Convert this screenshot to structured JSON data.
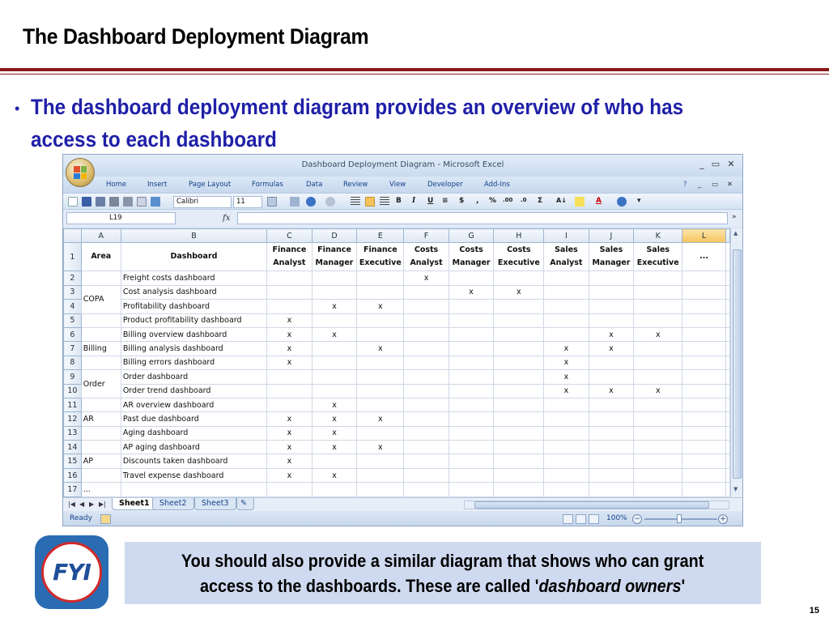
{
  "slide": {
    "title": "The Dashboard Deployment Diagram",
    "bullet": "The dashboard deployment diagram provides an overview of who has access to each dashboard",
    "bullet_line1": "The dashboard deployment diagram provides an overview of who has",
    "bullet_line2": "access to each dashboard",
    "note_pre": "You should also provide a similar diagram that shows who can grant",
    "note_line2_pre": "access to the dashboards. These are called '",
    "note_em": "dashboard owners",
    "note_post": "'",
    "fyi": "FYI",
    "page_number": "15",
    "accent_color": "#8b1a1a",
    "bullet_color": "#1f1fa8"
  },
  "excel": {
    "window_title": "Dashboard Deployment Diagram - Microsoft Excel",
    "ribbon_tabs": [
      "Home",
      "Insert",
      "Page Layout",
      "Formulas",
      "Data",
      "Review",
      "View",
      "Developer",
      "Add-Ins"
    ],
    "font_name": "Calibri",
    "font_size": "11",
    "name_box": "L19",
    "fx": "fx",
    "sheets": [
      "Sheet1",
      "Sheet2",
      "Sheet3"
    ],
    "active_sheet": "Sheet1",
    "status": "Ready",
    "zoom": "100%",
    "columns": [
      "A",
      "B",
      "C",
      "D",
      "E",
      "F",
      "G",
      "H",
      "I",
      "J",
      "K",
      "L"
    ],
    "selected_column": "L",
    "header_row": {
      "area": "Area",
      "dashboard": "Dashboard",
      "roles": [
        [
          "Finance",
          "Analyst"
        ],
        [
          "Finance",
          "Manager"
        ],
        [
          "Finance",
          "Executive"
        ],
        [
          "Costs",
          "Analyst"
        ],
        [
          "Costs",
          "Manager"
        ],
        [
          "Costs",
          "Executive"
        ],
        [
          "Sales",
          "Analyst"
        ],
        [
          "Sales",
          "Manager"
        ],
        [
          "Sales",
          "Executive"
        ]
      ],
      "more": "..."
    },
    "rows": [
      {
        "num": "2",
        "area": "",
        "dashboard": "Freight costs dashboard",
        "marks": [
          "",
          "",
          "",
          "x",
          "",
          "",
          "",
          "",
          ""
        ]
      },
      {
        "num": "3",
        "area": "",
        "dashboard": "Cost analysis dashboard",
        "marks": [
          "",
          "",
          "",
          "",
          "x",
          "x",
          "",
          "",
          ""
        ]
      },
      {
        "num": "4",
        "area": "",
        "dashboard": "Profitability dashboard",
        "marks": [
          "",
          "x",
          "x",
          "",
          "",
          "",
          "",
          "",
          ""
        ]
      },
      {
        "num": "5",
        "area": "",
        "dashboard": "Product profitability  dashboard",
        "marks": [
          "x",
          "",
          "",
          "",
          "",
          "",
          "",
          "",
          ""
        ]
      },
      {
        "num": "6",
        "area": "",
        "dashboard": "Billing overview dashboard",
        "marks": [
          "x",
          "x",
          "",
          "",
          "",
          "",
          "",
          "x",
          "x"
        ]
      },
      {
        "num": "7",
        "area": "Billing",
        "dashboard": "Billing analysis dashboard",
        "marks": [
          "x",
          "",
          "x",
          "",
          "",
          "",
          "x",
          "x",
          ""
        ]
      },
      {
        "num": "8",
        "area": "",
        "dashboard": "Billing errors dashboard",
        "marks": [
          "x",
          "",
          "",
          "",
          "",
          "",
          "x",
          "",
          ""
        ]
      },
      {
        "num": "9",
        "area": "",
        "dashboard": "Order dashboard",
        "marks": [
          "",
          "",
          "",
          "",
          "",
          "",
          "x",
          "",
          ""
        ]
      },
      {
        "num": "10",
        "area": "",
        "dashboard": "Order trend  dashboard",
        "marks": [
          "",
          "",
          "",
          "",
          "",
          "",
          "x",
          "x",
          "x"
        ]
      },
      {
        "num": "11",
        "area": "",
        "dashboard": "AR overview dashboard",
        "marks": [
          "",
          "x",
          "",
          "",
          "",
          "",
          "",
          "",
          ""
        ]
      },
      {
        "num": "12",
        "area": "AR",
        "dashboard": "Past due dashboard",
        "marks": [
          "x",
          "x",
          "x",
          "",
          "",
          "",
          "",
          "",
          ""
        ]
      },
      {
        "num": "13",
        "area": "",
        "dashboard": "Aging  dashboard",
        "marks": [
          "x",
          "x",
          "",
          "",
          "",
          "",
          "",
          "",
          ""
        ]
      },
      {
        "num": "14",
        "area": "",
        "dashboard": "AP aging dashboard",
        "marks": [
          "x",
          "x",
          "x",
          "",
          "",
          "",
          "",
          "",
          ""
        ]
      },
      {
        "num": "15",
        "area": "AP",
        "dashboard": "Discounts taken dashboard",
        "marks": [
          "x",
          "",
          "",
          "",
          "",
          "",
          "",
          "",
          ""
        ]
      },
      {
        "num": "16",
        "area": "",
        "dashboard": "Travel expense dashboard",
        "marks": [
          "x",
          "x",
          "",
          "",
          "",
          "",
          "",
          "",
          ""
        ]
      },
      {
        "num": "17",
        "area": "...",
        "dashboard": "",
        "marks": [
          "",
          "",
          "",
          "",
          "",
          "",
          "",
          "",
          ""
        ]
      }
    ],
    "merged_areas": [
      {
        "label": "COPA",
        "start_row": "3",
        "span": 2
      },
      {
        "label": "Order",
        "start_row": "9",
        "span": 2
      }
    ]
  }
}
